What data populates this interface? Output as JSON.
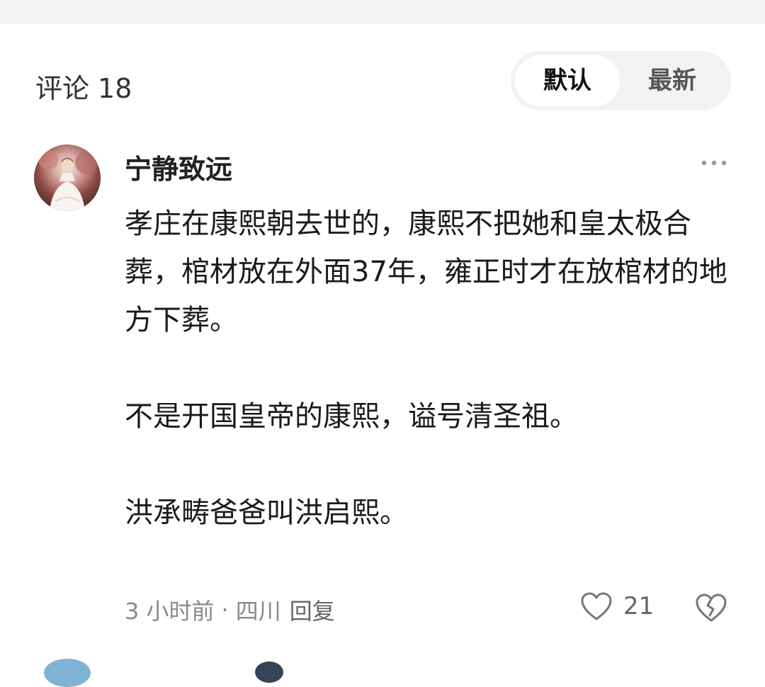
{
  "header": {
    "comments_label": "评论",
    "comments_count": "18",
    "sort_options": [
      {
        "label": "默认",
        "active": true
      },
      {
        "label": "最新",
        "active": false
      }
    ]
  },
  "comment": {
    "username": "宁静致远",
    "avatar_icon": "avatar-photo",
    "more_icon": "more-horizontal-icon",
    "paragraphs": [
      "孝庄在康熙朝去世的，康熙不把她和皇太极合葬，棺材放在外面37年，雍正时才在放棺材的地方下葬。",
      "不是开国皇帝的康熙，谥号清圣祖。",
      "洪承畴爸爸叫洪启熙。"
    ],
    "time": "3 小时前",
    "separator": "·",
    "location": "四川",
    "reply_label": "回复",
    "like_icon": "heart-icon",
    "like_count": "21",
    "dislike_icon": "broken-heart-icon"
  },
  "colors": {
    "text_primary": "#1a1a1a",
    "text_secondary": "#8a8a8a",
    "toggle_bg": "#f2f2f4"
  }
}
